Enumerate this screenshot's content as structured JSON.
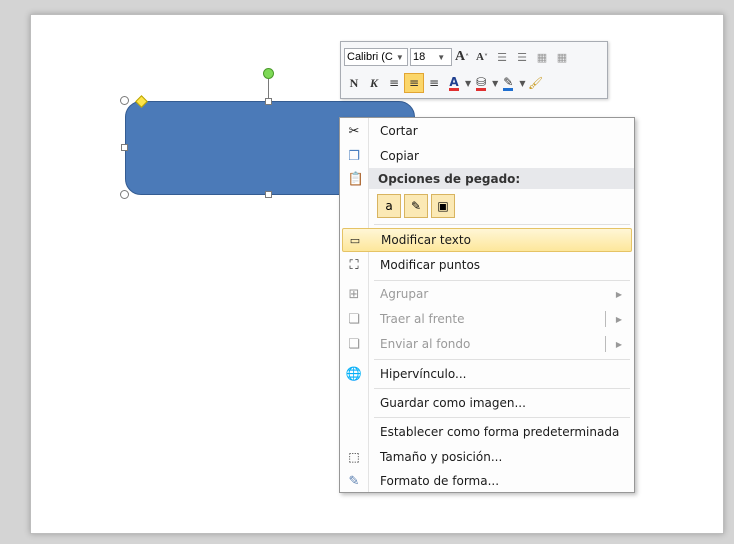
{
  "mini_toolbar": {
    "font_name": "Calibri (C",
    "font_size": "18",
    "grow_font": "A",
    "shrink_font": "A",
    "bold": "N",
    "italic": "K",
    "font_color_letter": "A"
  },
  "menu": {
    "cut": "Cortar",
    "copy": "Copiar",
    "paste_options_header": "Opciones de pegado:",
    "edit_text": "Modificar texto",
    "edit_points": "Modificar puntos",
    "group": "Agrupar",
    "bring_front": "Traer al frente",
    "send_back": "Enviar al fondo",
    "hyperlink": "Hipervínculo...",
    "save_as_image": "Guardar como imagen...",
    "set_default_shape": "Establecer como forma predeterminada",
    "size_position": "Tamaño y posición...",
    "format_shape": "Formato de forma..."
  },
  "colors": {
    "shape_fill": "#4b7ab8",
    "highlight": "#fde79b",
    "font_color": "#e03030"
  }
}
